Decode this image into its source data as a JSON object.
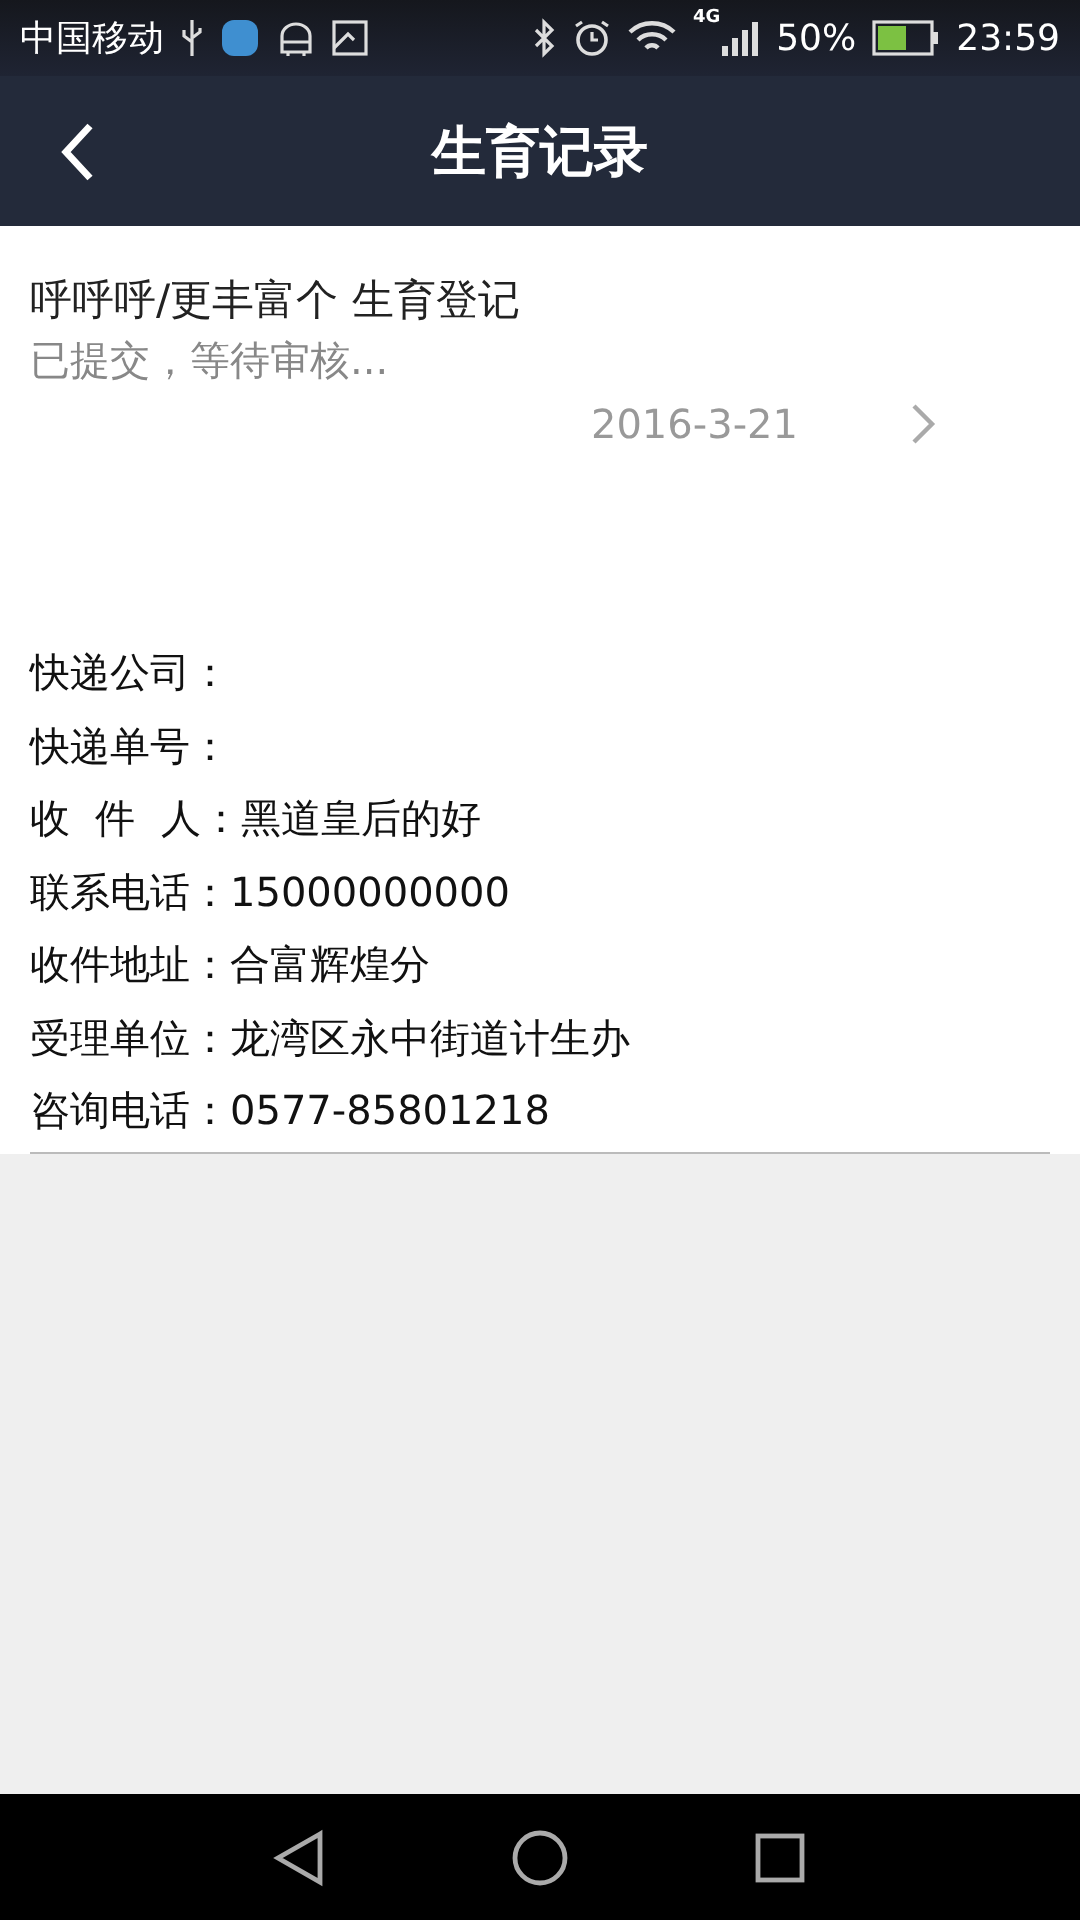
{
  "status_bar": {
    "carrier": "中国移动",
    "network": "4G",
    "battery": "50%",
    "time": "23:59"
  },
  "header": {
    "title": "生育记录"
  },
  "record": {
    "title": "呼呼呼/更丰富个 生育登记",
    "status": "已提交，等待审核...",
    "date": "2016-3-21"
  },
  "details": [
    "快递公司：",
    "快递单号：",
    "收  件  人：黑道皇后的好",
    "联系电话：15000000000",
    "收件地址：合富辉煌分",
    "受理单位：龙湾区永中街道计生办",
    "咨询电话：0577-85801218"
  ]
}
